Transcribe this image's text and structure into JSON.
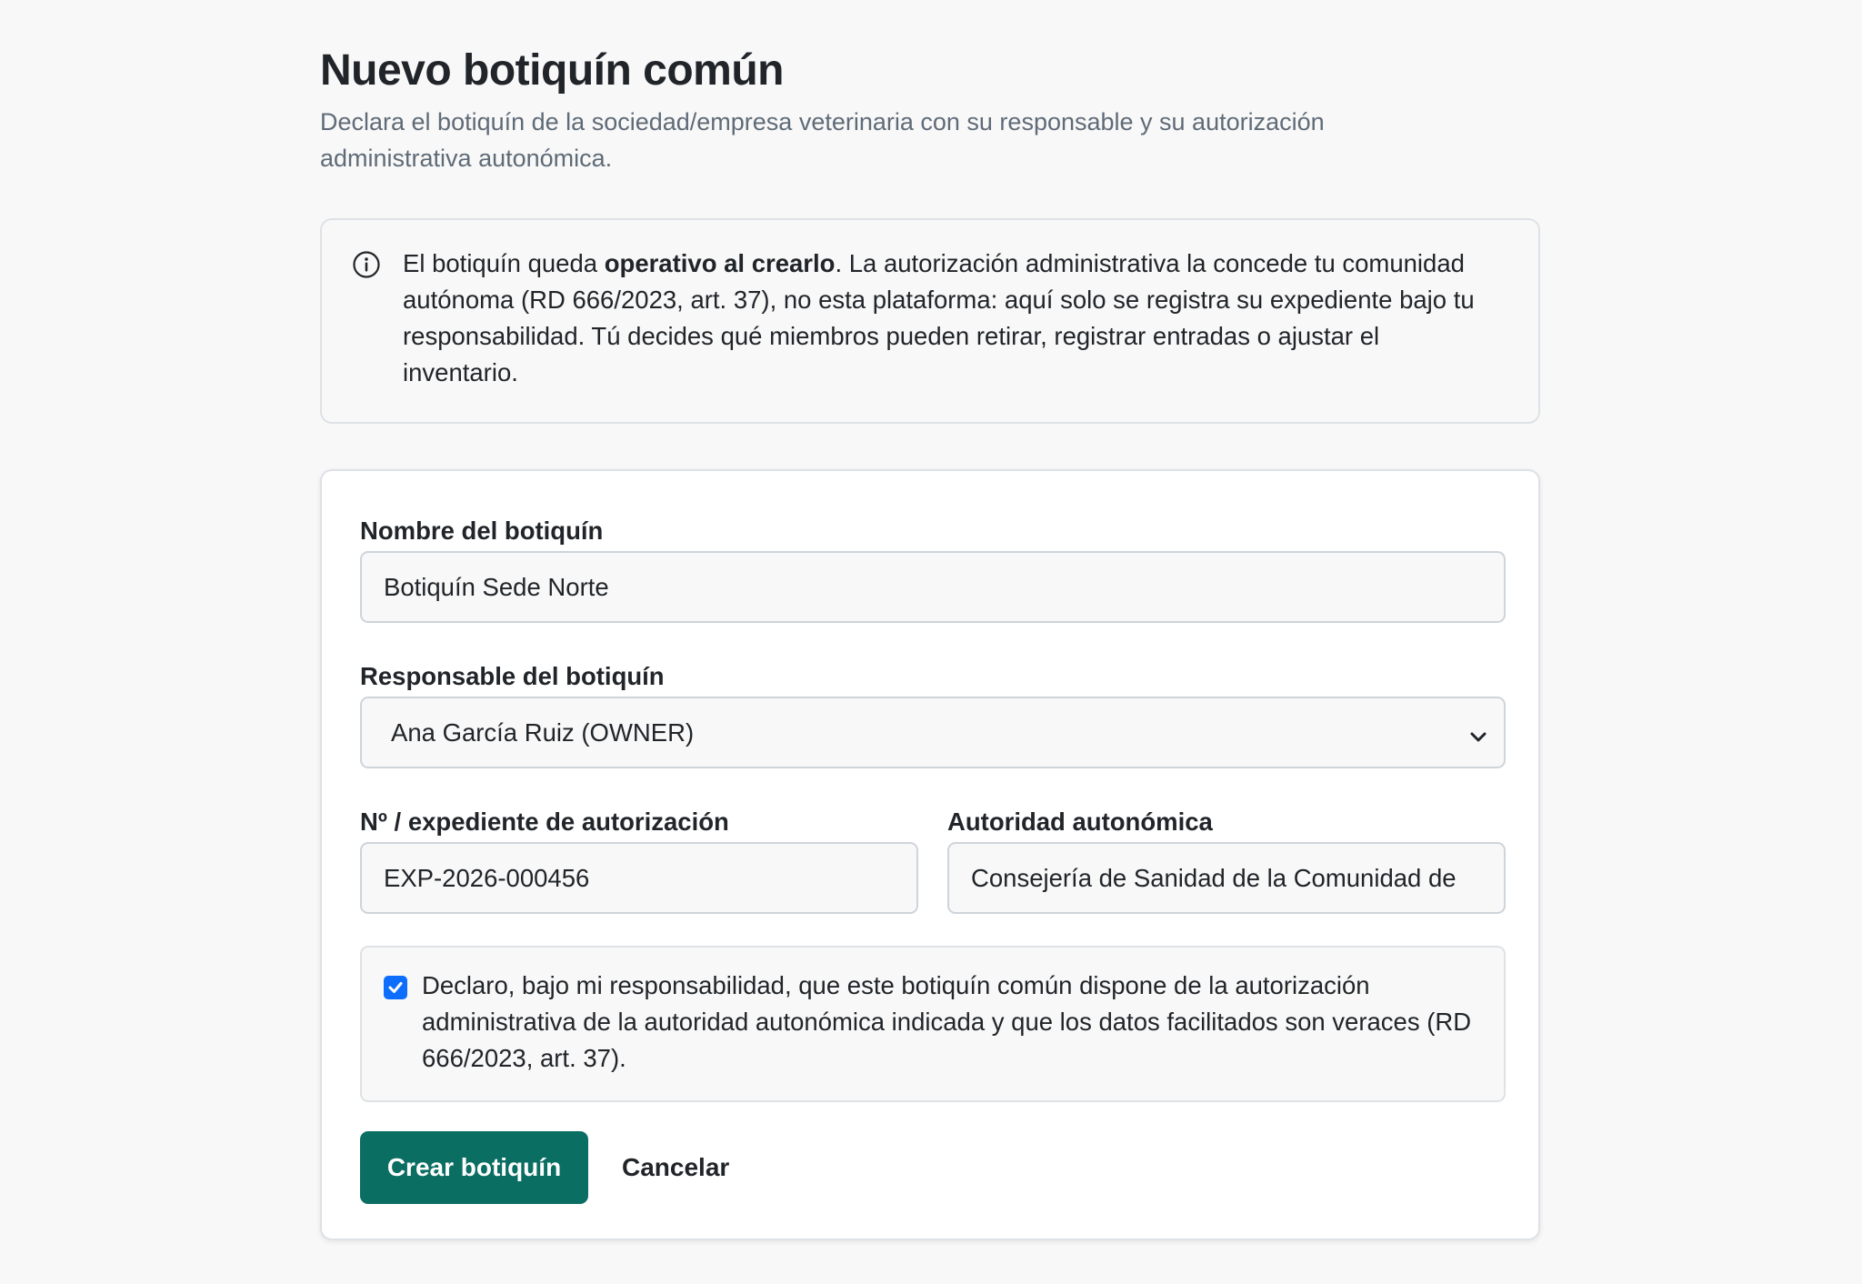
{
  "header": {
    "title": "Nuevo botiquín común",
    "subtitle": "Declara el botiquín de la sociedad/empresa veterinaria con su responsable y su autorización administrativa autonómica."
  },
  "info": {
    "icon": "info-circle-icon",
    "text_before": "El botiquín queda ",
    "text_bold": "operativo al crearlo",
    "text_after": ". La autorización administrativa la concede tu comunidad autónoma (RD 666/2023, art. 37), no esta plataforma: aquí solo se registra su expediente bajo tu responsabilidad. Tú decides qué miembros pueden retirar, registrar entradas o ajustar el inventario."
  },
  "form": {
    "name_label": "Nombre del botiquín",
    "name_value": "Botiquín Sede Norte",
    "responsible_label": "Responsable del botiquín",
    "responsible_value": "Ana García Ruiz (OWNER)",
    "auth_number_label": "Nº / expediente de autorización",
    "auth_number_value": "EXP-2026-000456",
    "authority_label": "Autoridad autonómica",
    "authority_value": "Consejería de Sanidad de la Comunidad de",
    "declaration_checked": true,
    "declaration_text": "Declaro, bajo mi responsabilidad, que este botiquín común dispone de la autorización administrativa de la autoridad autonómica indicada y que los datos facilitados son veraces (RD 666/2023, art. 37).",
    "submit_label": "Crear botiquín",
    "cancel_label": "Cancelar"
  },
  "colors": {
    "primary": "#0b6e63",
    "checkbox": "#0d6efd",
    "background": "#f8f8f8",
    "muted_text": "#5f6b77"
  }
}
